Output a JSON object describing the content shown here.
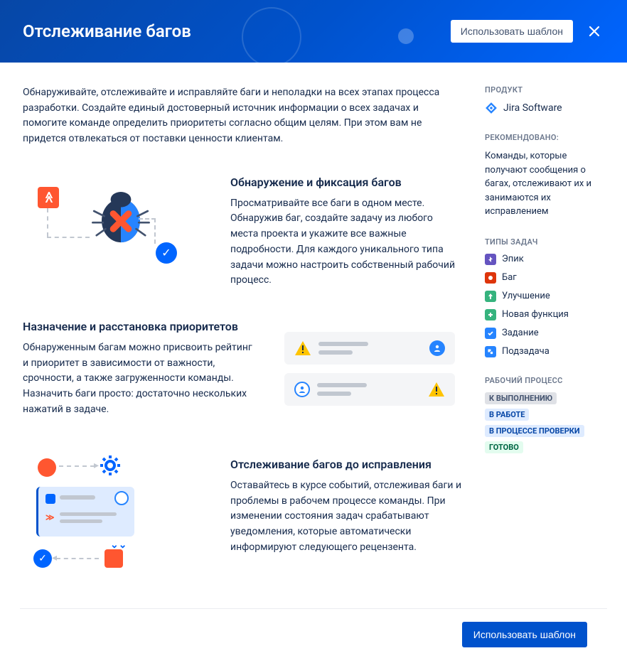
{
  "header": {
    "title": "Отслеживание багов",
    "use_template": "Использовать шаблон"
  },
  "intro": "Обнаруживайте, отслеживайте и исправляйте баги и неполадки на всех этапах процесса разработки. Создайте единый достоверный источник информации о всех задачах и помогите команде определить приоритеты согласно общим целям. При этом вам не придется отвлекаться от поставки ценности клиентам.",
  "features": [
    {
      "title": "Обнаружение и фиксация багов",
      "body": "Просматривайте все баги в одном месте. Обнаружив баг, создайте задачу из любого места проекта и укажите все важные подробности. Для каждого уникального типа задачи можно настроить собственный рабочий процесс."
    },
    {
      "title": "Назначение и расстановка приоритетов",
      "body": "Обнаруженным багам можно присвоить рейтинг и приоритет в зависимости от важности, срочности, а также загруженности команды. Назначить баги просто: достаточно нескольких нажатий в задаче."
    },
    {
      "title": "Отслеживание багов до исправления",
      "body": "Оставайтесь в курсе событий, отслеживая баги и проблемы в рабочем процессе команды. При изменении состояния задач срабатывают уведомления, которые автоматически информируют следующего рецензента."
    }
  ],
  "sidebar": {
    "product_label": "ПРОДУКТ",
    "product_name": "Jira Software",
    "recommended_label": "РЕКОМЕНДОВАНО:",
    "recommended_text": "Команды, которые получают сообщения о багах, отслеживают их и занимаются их исправлением",
    "issue_types_label": "ТИПЫ ЗАДАЧ",
    "issue_types": [
      "Эпик",
      "Баг",
      "Улучшение",
      "Новая функция",
      "Задание",
      "Подзадача"
    ],
    "workflow_label": "РАБОЧИЙ ПРОЦЕСС",
    "workflow": [
      "К ВЫПОЛНЕНИЮ",
      "В РАБОТЕ",
      "В ПРОЦЕССЕ ПРОВЕРКИ",
      "ГОТОВО"
    ]
  },
  "footer": {
    "use_template": "Использовать шаблон"
  }
}
